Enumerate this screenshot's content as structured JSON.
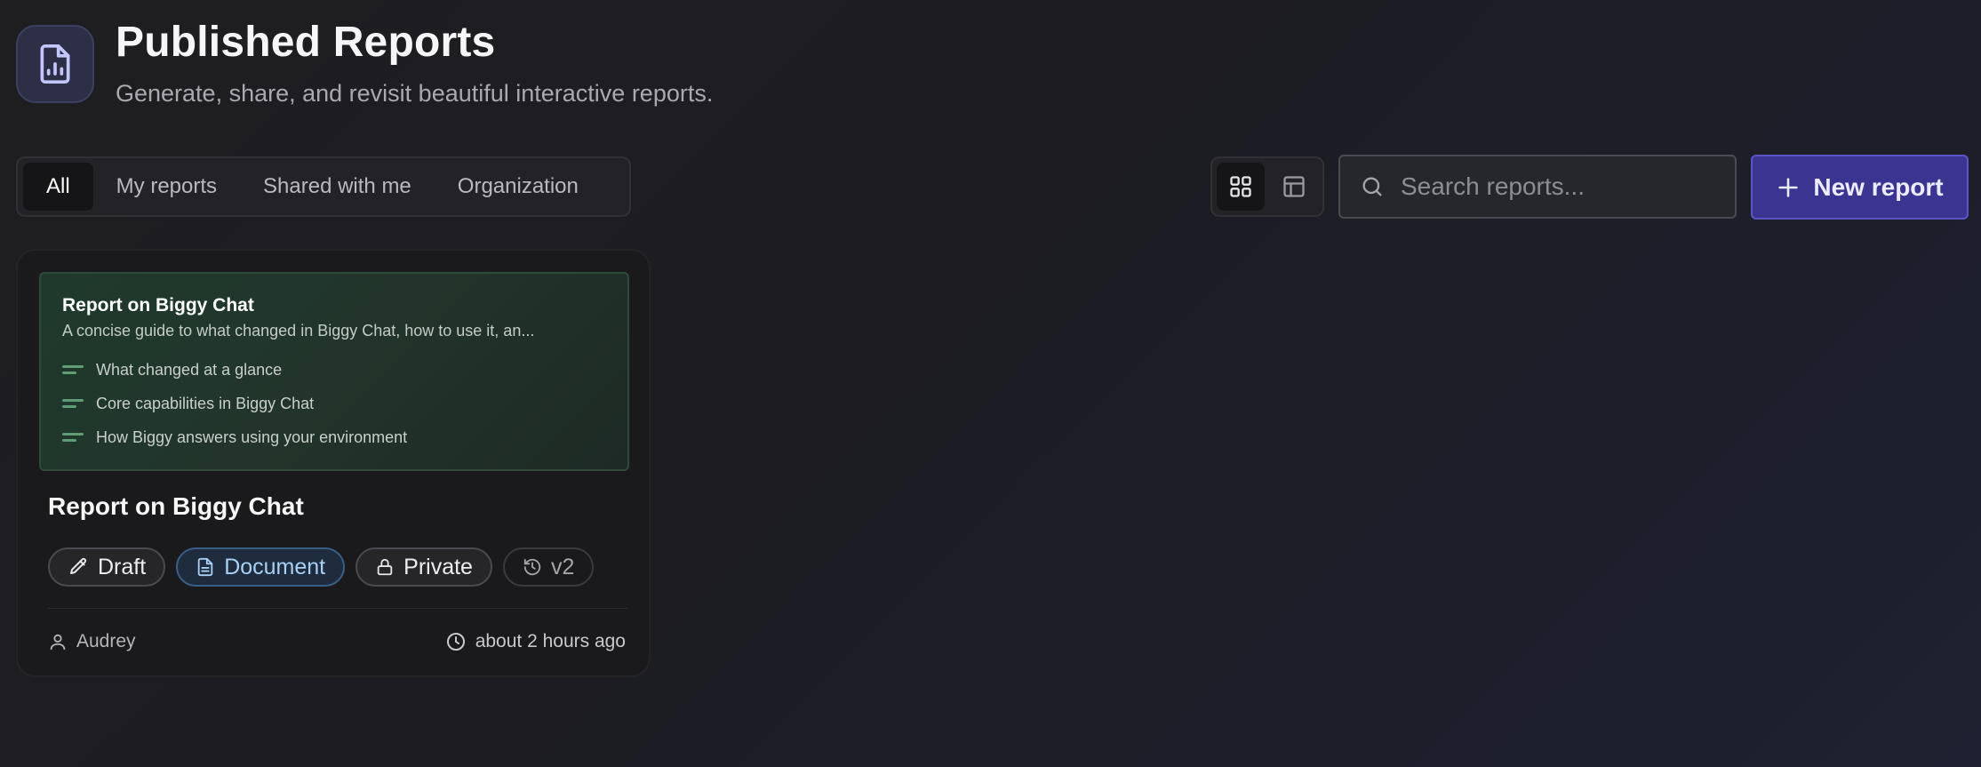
{
  "header": {
    "title": "Published Reports",
    "subtitle": "Generate, share, and revisit beautiful interactive reports.",
    "icon": "file-chart-icon"
  },
  "tabs": [
    {
      "label": "All",
      "active": true
    },
    {
      "label": "My reports",
      "active": false
    },
    {
      "label": "Shared with me",
      "active": false
    },
    {
      "label": "Organization",
      "active": false
    }
  ],
  "view_toggle": {
    "grid_icon": "grid-icon",
    "table_icon": "table-icon",
    "active": "grid"
  },
  "search": {
    "placeholder": "Search reports...",
    "value": ""
  },
  "new_report": {
    "label": "New report",
    "icon": "plus-icon"
  },
  "colors": {
    "accent": "#3a3591",
    "preview_bg": "#1f3a2d",
    "document_badge": "#a8d0f5"
  },
  "cards": [
    {
      "preview": {
        "title": "Report on Biggy Chat",
        "description": "A concise guide to what changed in Biggy Chat, how to use it, an...",
        "sections": [
          "What changed at a glance",
          "Core capabilities in Biggy Chat",
          "How Biggy answers using your environment"
        ]
      },
      "title": "Report on Biggy Chat",
      "badges": {
        "status": "Draft",
        "type": "Document",
        "visibility": "Private",
        "version": "v2"
      },
      "author": "Audrey",
      "updated": "about 2 hours ago"
    }
  ]
}
